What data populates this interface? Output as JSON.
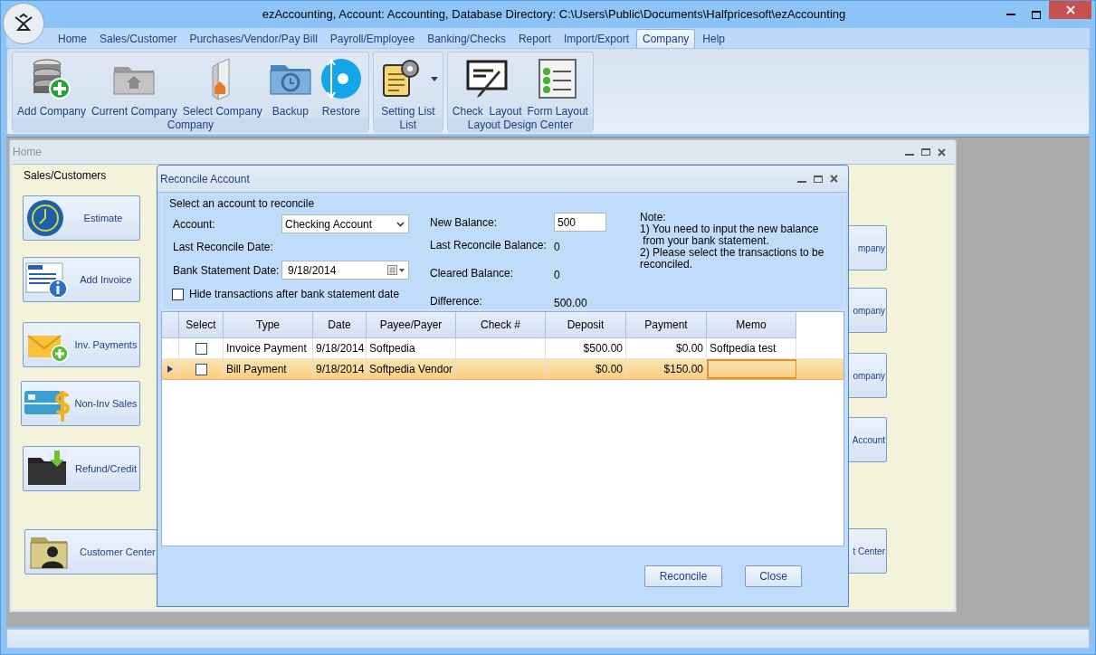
{
  "window": {
    "title": "ezAccounting, Account: Accounting, Database Directory: C:\\Users\\Public\\Documents\\Halfpricesoft\\ezAccounting"
  },
  "menu_tabs": [
    {
      "label": "Home",
      "selected": false
    },
    {
      "label": "Sales/Customer",
      "selected": false
    },
    {
      "label": "Purchases/Vendor/Pay Bill",
      "selected": false
    },
    {
      "label": "Payroll/Employee",
      "selected": false
    },
    {
      "label": "Banking/Checks",
      "selected": false
    },
    {
      "label": "Report",
      "selected": false
    },
    {
      "label": "Import/Export",
      "selected": false
    },
    {
      "label": "Company",
      "selected": true
    },
    {
      "label": "Help",
      "selected": false
    }
  ],
  "ribbon_groups": [
    {
      "title": "Company",
      "items": [
        {
          "label": "Add Company",
          "kind": "database"
        },
        {
          "label": "Current Company",
          "kind": "folder"
        },
        {
          "label": "Select Company",
          "kind": "document"
        },
        {
          "label": "Backup",
          "kind": "backup"
        },
        {
          "label": "Restore",
          "kind": "restore"
        }
      ]
    },
    {
      "title": "List",
      "items": [
        {
          "label": "Setting List",
          "kind": "settings",
          "dropdown": true
        }
      ]
    },
    {
      "title": "Layout Design Center",
      "items": [
        {
          "label": "Check  Layout",
          "kind": "check"
        },
        {
          "label": "Form Layout",
          "kind": "form"
        }
      ]
    }
  ],
  "home_window": {
    "title": "Home",
    "group_label": "Sales/Customers",
    "left_buttons": [
      {
        "label": "Estimate",
        "kind": "clock"
      },
      {
        "label": "Add Invoice",
        "kind": "invoice"
      },
      {
        "label": "Inv. Payments",
        "kind": "envelope"
      },
      {
        "label": "Non-Inv Sales",
        "kind": "card"
      },
      {
        "label": "Refund/Credit",
        "kind": "folder"
      },
      {
        "label": "Customer Center",
        "kind": "person"
      }
    ],
    "right_buttons": [
      {
        "label": "mpany"
      },
      {
        "label": "ompany"
      },
      {
        "label": "ompany"
      },
      {
        "label": "Account"
      },
      {
        "label": "t Center"
      }
    ]
  },
  "dialog": {
    "title": "Reconcile Account",
    "section": "Select an account to reconcile",
    "account_label": "Account:",
    "account_value": "Checking Account",
    "last_reconcile_date_label": "Last Reconcile Date:",
    "bank_statement_date_label": "Bank Statement Date:",
    "bank_statement_date": "9/18/2014",
    "hide_transactions": {
      "label": "Hide transactions after bank statement date",
      "checked": false
    },
    "new_balance_label": "New Balance:",
    "new_balance": "500",
    "summary": [
      {
        "label": "Last Reconcile Balance:",
        "value": "0"
      },
      {
        "label": "Cleared Balance:",
        "value": "0"
      },
      {
        "label": "Difference:",
        "value": "500.00"
      }
    ],
    "note_title": "Note:",
    "note_lines": [
      "1) You need to input the new balance",
      " from your bank statement.",
      "2) Please select the transactions to be",
      "reconciled."
    ],
    "table": {
      "columns": [
        "Select",
        "Type",
        "Date",
        "Payee/Payer",
        "Check #",
        "Deposit",
        "Payment",
        "Memo"
      ],
      "rows": [
        {
          "selected": false,
          "checked": false,
          "type": "Invoice Payment",
          "date": "9/18/2014",
          "payee": "Softpedia",
          "deposit": "$500.00",
          "payment": "$0.00",
          "memo": "Softpedia test"
        },
        {
          "selected": true,
          "checked": false,
          "type": "Bill Payment",
          "date": "9/18/2014",
          "payee": "Softpedia Vendor",
          "deposit": "$0.00",
          "payment": "$150.00"
        }
      ]
    },
    "buttons": [
      "Reconcile",
      "Close"
    ]
  }
}
